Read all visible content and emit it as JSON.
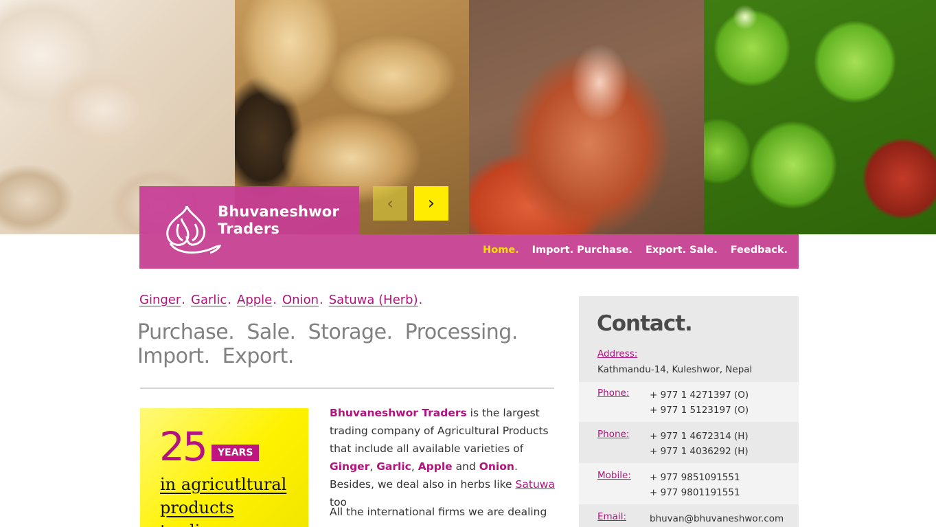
{
  "brand": {
    "name_line1": "Bhuvaneshwor",
    "name_line2": "Traders"
  },
  "slider": {
    "prev": "‹",
    "next": "›"
  },
  "nav": [
    {
      "label": "Home."
    },
    {
      "label": "Import. Purchase."
    },
    {
      "label": "Export. Sale."
    },
    {
      "label": "Feedback."
    }
  ],
  "products": [
    "Ginger",
    "Garlic",
    "Apple",
    "Onion",
    "Satuwa (Herb)"
  ],
  "tagline": {
    "line1": "Purchase.  Sale.  Storage.  Processing.",
    "line2": "Import.  Export."
  },
  "years": {
    "number": "25",
    "badge": "YEARS",
    "text": "in agricutltural products trading"
  },
  "intro": {
    "company": "Bhuvaneshwor Traders",
    "t1": " is the largest trading company of Agricultural Products that include all available varieties of ",
    "ginger": "Ginger",
    "garlic": "Garlic",
    "apple": "Apple",
    "and": " and ",
    "onion": "Onion",
    "t2": ". Besides, we deal also in herbs like ",
    "satuwa": "Satuwa",
    "t3": " too",
    "para2": "All the international firms we are dealing"
  },
  "contact": {
    "title": "Contact.",
    "address_label": "Address:",
    "address": "Kathmandu-14, Kuleshwor, Nepal",
    "phone1_label": "Phone:",
    "phone1_a": "+ 977 1 4271397 (O)",
    "phone1_b": "+ 977 1 5123197 (O)",
    "phone2_label": "Phone:",
    "phone2_a": "+ 977 1 4672314 (H)",
    "phone2_b": "+ 977 1 4036292 (H)",
    "mobile_label": "Mobile:",
    "mobile_a": "+ 977 9851091551",
    "mobile_b": "+ 977 9801191551",
    "email_label": "Email:",
    "email": "bhuvan@bhuvaneshwor.com"
  }
}
